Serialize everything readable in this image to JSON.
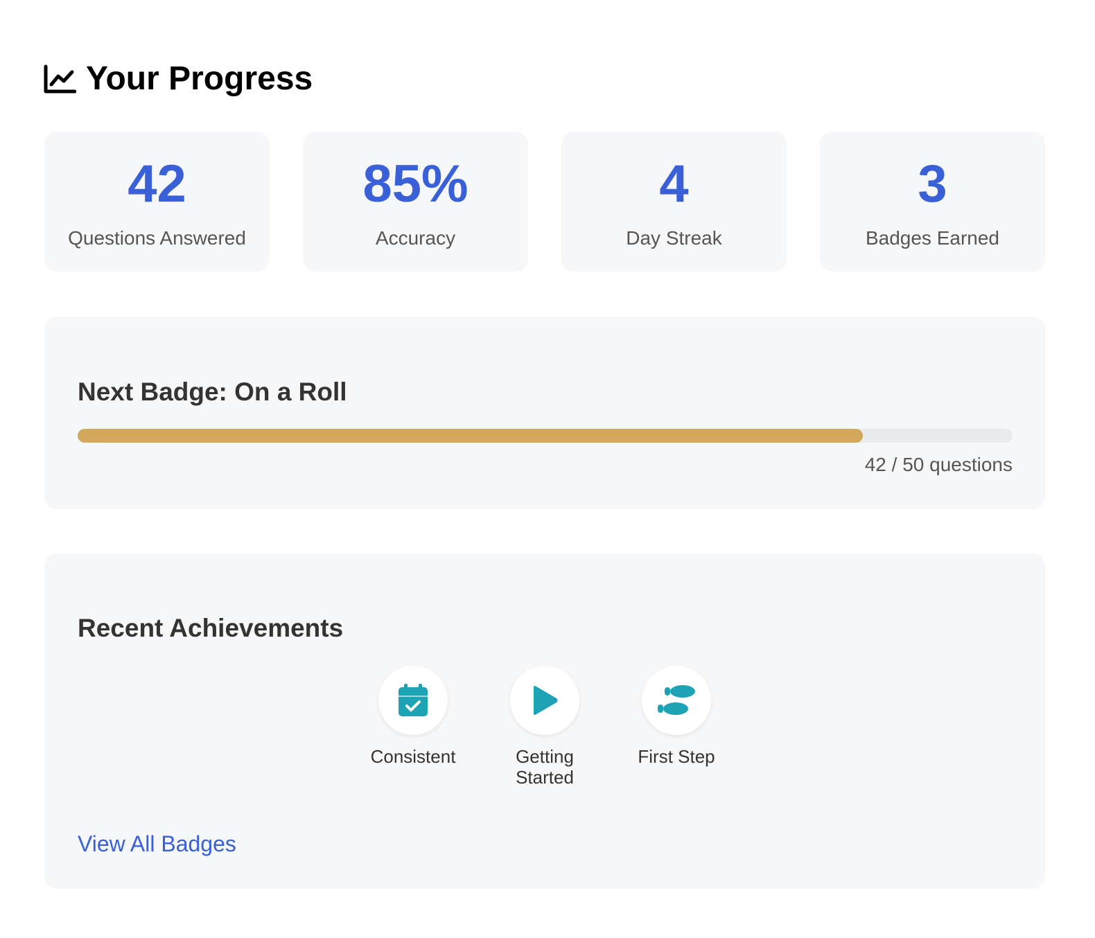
{
  "header": {
    "title": "Your Progress",
    "icon": "chart-line-icon"
  },
  "stats": [
    {
      "value": "42",
      "label": "Questions Answered"
    },
    {
      "value": "85%",
      "label": "Accuracy"
    },
    {
      "value": "4",
      "label": "Day Streak"
    },
    {
      "value": "3",
      "label": "Badges Earned"
    }
  ],
  "next_badge": {
    "title": "Next Badge: On a Roll",
    "current": 42,
    "target": 50,
    "progress_fraction": 0.84,
    "progress_text": "42 / 50 questions"
  },
  "achievements": {
    "title": "Recent Achievements",
    "items": [
      {
        "name": "Consistent",
        "icon": "calendar-check-icon"
      },
      {
        "name": "Getting Started",
        "icon": "play-icon"
      },
      {
        "name": "First Step",
        "icon": "shoe-prints-icon"
      }
    ],
    "view_all_label": "View All Badges"
  },
  "colors": {
    "accent": "#3a60d8",
    "progress_fill": "#d4a85a",
    "badge_icon": "#1ea3b5",
    "card_bg": "#f6f7f8"
  }
}
